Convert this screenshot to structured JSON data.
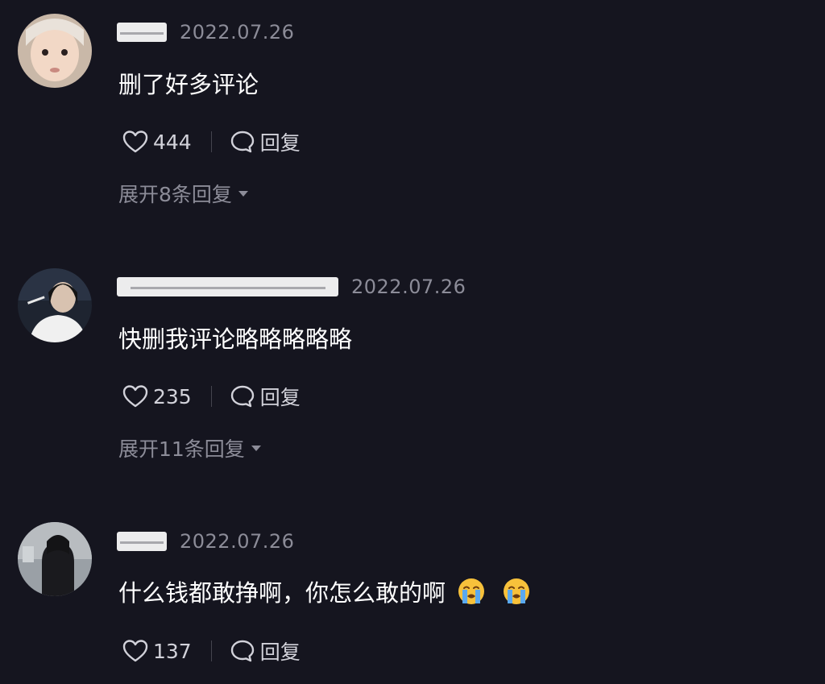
{
  "comments": [
    {
      "username": "",
      "date": "2022.07.26",
      "text": "删了好多评论",
      "likes": "444",
      "reply_label": "回复",
      "expand_label": "展开8条回复",
      "emojis": []
    },
    {
      "username": "",
      "date": "2022.07.26",
      "text": "快删我评论略略略略略",
      "likes": "235",
      "reply_label": "回复",
      "expand_label": "展开11条回复",
      "emojis": []
    },
    {
      "username": "",
      "date": "2022.07.26",
      "text": "什么钱都敢挣啊，你怎么敢的啊",
      "likes": "137",
      "reply_label": "回复",
      "expand_label": "",
      "emojis": [
        "loudly-crying-face",
        "loudly-crying-face"
      ]
    }
  ],
  "colors": {
    "background": "#15151f",
    "date_text": "#8c8c98",
    "action_text": "#d2d2da"
  }
}
